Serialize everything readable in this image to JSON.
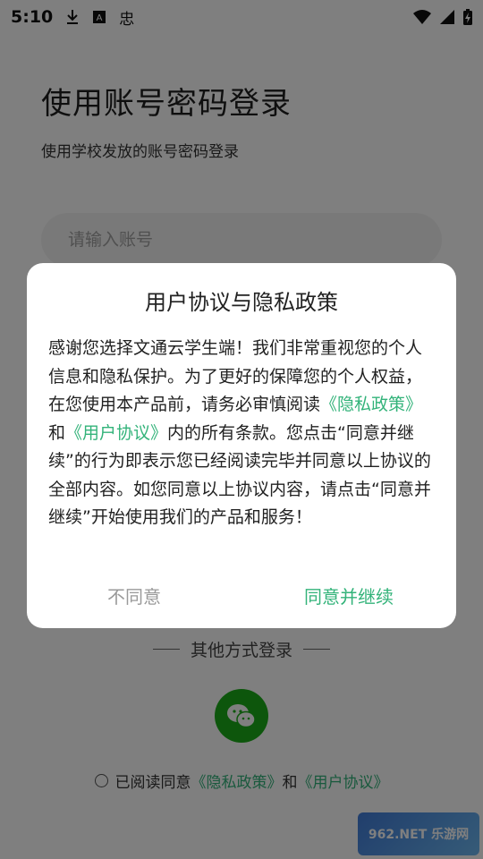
{
  "status_bar": {
    "time": "5:10",
    "notification_glyph": "忠"
  },
  "page": {
    "title": "使用账号密码登录",
    "subtitle": "使用学校发放的账号密码登录",
    "account_placeholder": "请输入账号",
    "other_login": "其他方式登录",
    "agree_prefix": "已阅读同意",
    "agree_privacy": "《隐私政策》",
    "agree_and": "和",
    "agree_user": "《用户协议》"
  },
  "dialog": {
    "title": "用户协议与隐私政策",
    "body_part1": "感谢您选择文通云学生端！我们非常重视您的个人信息和隐私保护。为了更好的保障您的个人权益，在您使用本产品前，请务必审慎阅读",
    "privacy_link": "《隐私政策》",
    "and": "和",
    "user_link": "《用户协议》",
    "body_part2": "内的所有条款。您点击“同意并继续”的行为即表示您已经阅读完毕并同意以上协议的全部内容。如您同意以上协议内容，请点击“同意并继续”开始使用我们的产品和服务！",
    "disagree_label": "不同意",
    "agree_label": "同意并继续"
  },
  "watermark": {
    "text": "962.NET 乐游网"
  },
  "colors": {
    "accent_green": "#33b37a",
    "wechat_green": "#1aad19"
  }
}
